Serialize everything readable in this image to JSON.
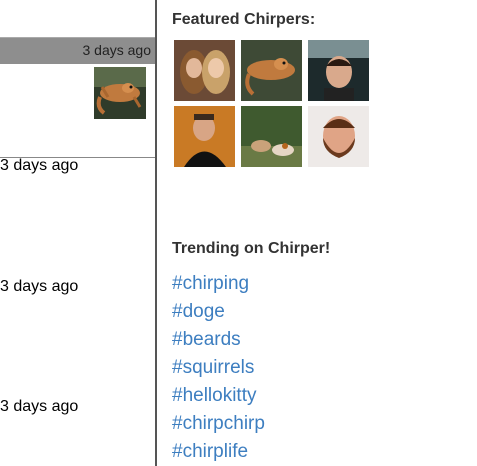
{
  "feed": {
    "posts": [
      {
        "time_label": "3 days ago"
      },
      {
        "time_label": "3 days ago"
      },
      {
        "time_label": "3 days ago"
      },
      {
        "time_label": "3 days ago"
      }
    ]
  },
  "sidebar": {
    "featured_title": "Featured Chirpers:",
    "trending_title": "Trending on Chirper!",
    "hashtags": [
      "#chirping",
      "#doge",
      "#beards",
      "#squirrels",
      "#hellokitty",
      "#chirpchirp",
      "#chirplife"
    ]
  },
  "colors": {
    "link": "#3d7ec0",
    "bar": "#8e8e8e"
  },
  "icons": [
    "flying-squirrel-photo",
    "women-avatar",
    "squirrel-avatar",
    "man-car-avatar",
    "man-dark-avatar",
    "dogs-avatar",
    "bearded-man-avatar"
  ]
}
